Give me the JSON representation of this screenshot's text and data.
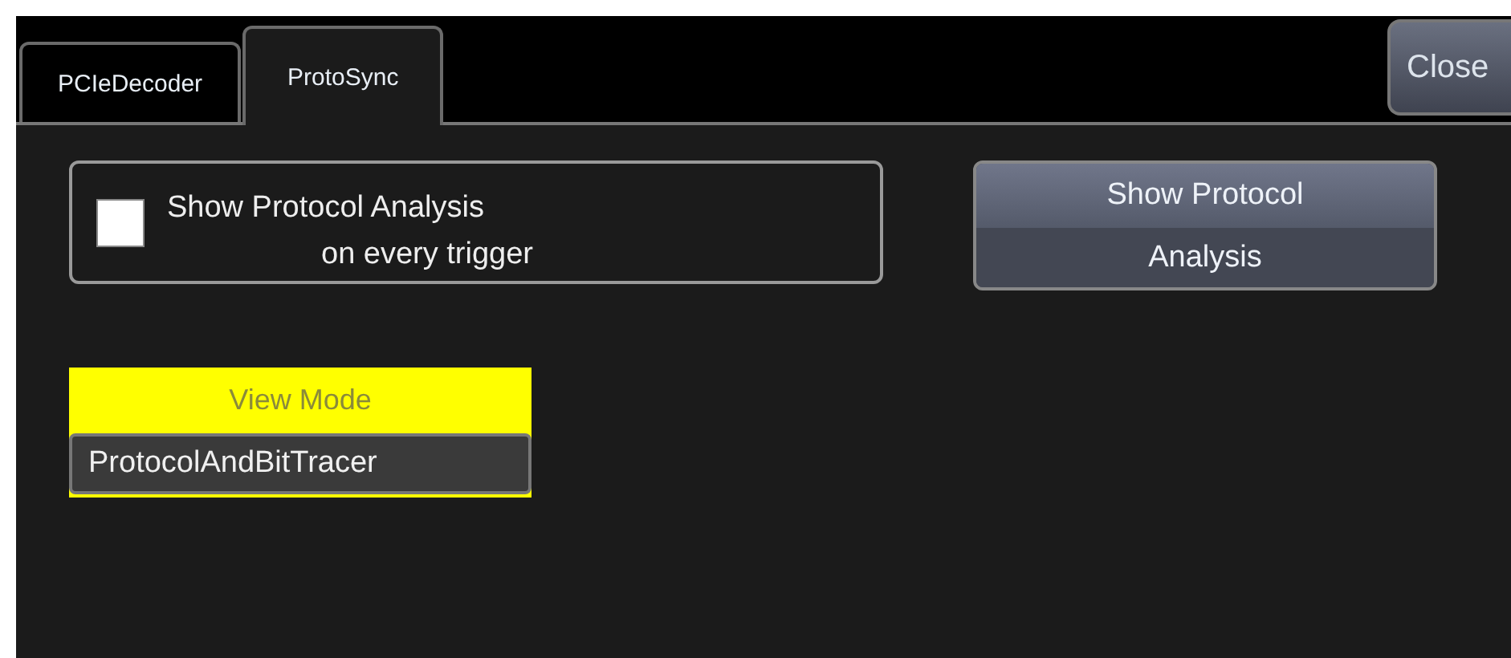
{
  "tabs": [
    {
      "label": "PCIeDecoder",
      "selected": false
    },
    {
      "label": "ProtoSync",
      "selected": true
    }
  ],
  "close_button": {
    "label": "Close"
  },
  "show_on_trigger": {
    "label_line_1": "Show Protocol Analysis",
    "label_line_2": "on every trigger",
    "checked": false
  },
  "show_button": {
    "label_line_1": "Show Protocol",
    "label_line_2": "Analysis"
  },
  "view_mode": {
    "label": "View Mode",
    "value": "ProtocolAndBitTracer"
  }
}
